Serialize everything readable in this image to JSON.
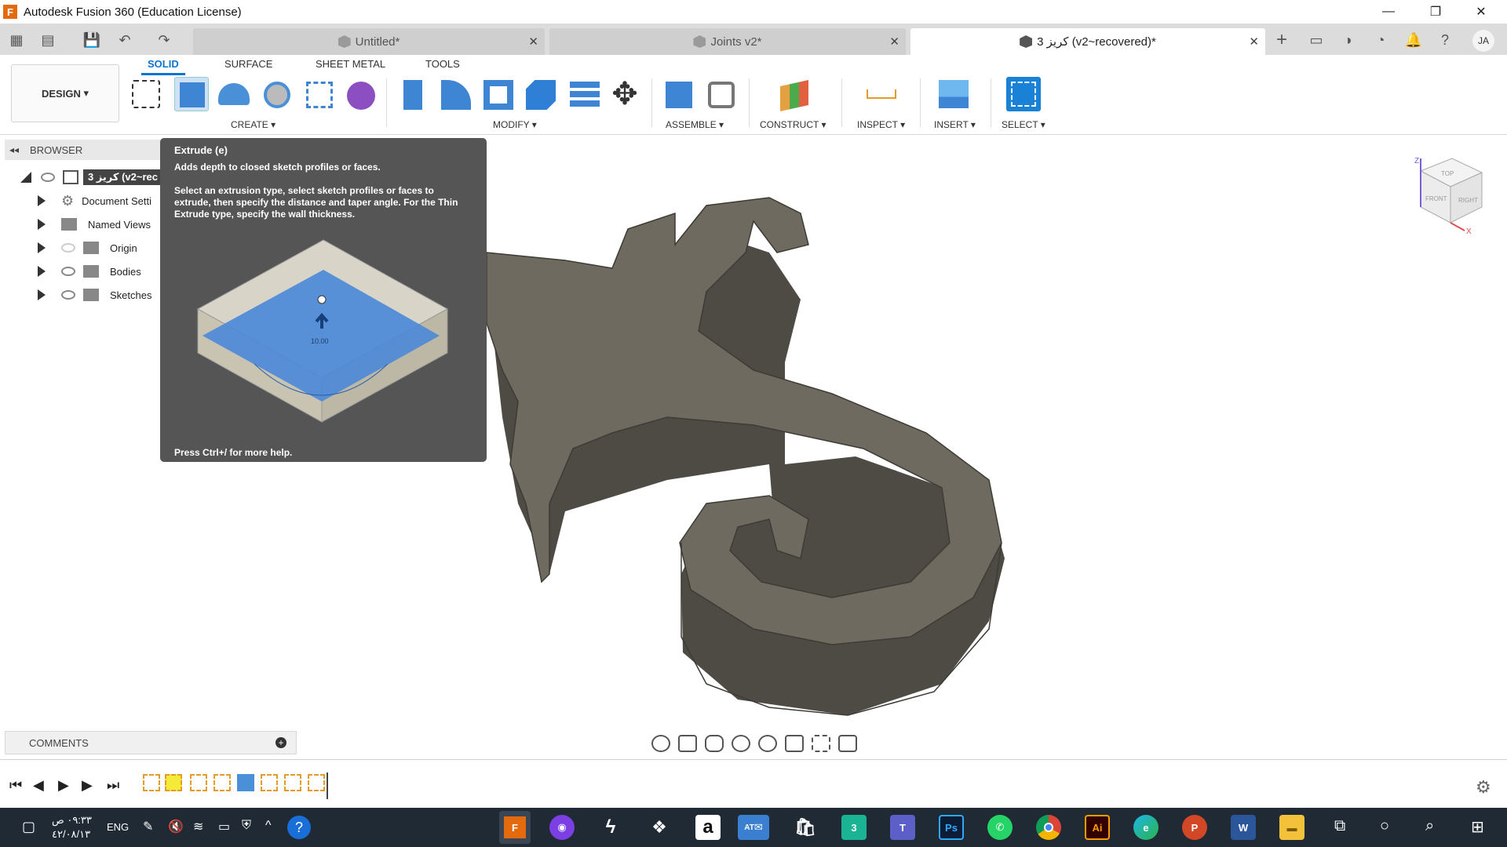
{
  "window": {
    "title": "Autodesk Fusion 360 (Education License)",
    "app_icon_letter": "F"
  },
  "tabs": [
    {
      "label": "Untitled*",
      "active": false
    },
    {
      "label": "Joints v2*",
      "active": false
    },
    {
      "label": "كريز 3 (v2~recovered)*",
      "active": true
    }
  ],
  "user": {
    "initials": "JA"
  },
  "ribbon": {
    "workspace": "DESIGN",
    "tabs": [
      "SOLID",
      "SURFACE",
      "SHEET METAL",
      "TOOLS"
    ],
    "groups": {
      "create": "CREATE",
      "modify": "MODIFY",
      "assemble": "ASSEMBLE",
      "construct": "CONSTRUCT",
      "inspect": "INSPECT",
      "insert": "INSERT",
      "select": "SELECT"
    }
  },
  "browser": {
    "header": "BROWSER",
    "root": "كريز 3 (v2~rec",
    "items": [
      {
        "label": "Document Setti"
      },
      {
        "label": "Named Views"
      },
      {
        "label": "Origin"
      },
      {
        "label": "Bodies"
      },
      {
        "label": "Sketches"
      }
    ]
  },
  "tooltip": {
    "title": "Extrude (e)",
    "description": "Adds depth to closed sketch profiles or faces.",
    "detail": "Select an extrusion type, select sketch profiles or faces to extrude, then specify the distance and taper angle. For the Thin Extrude type, specify the wall thickness.",
    "help": "Press Ctrl+/ for more help.",
    "preview_value": "10.00"
  },
  "viewcube": {
    "top": "TOP",
    "front": "FRONT",
    "right": "RIGHT",
    "axis_z": "Z",
    "axis_x": "X"
  },
  "comments": {
    "label": "COMMENTS"
  },
  "taskbar": {
    "time": "٠٩:٣٣ ص",
    "date": "٤٢/٠٨/١٣",
    "lang": "ENG",
    "mail_badge": "AT",
    "apps": [
      "F",
      "3",
      "Ps",
      "Ai",
      "P",
      "W"
    ]
  },
  "colors": {
    "accent": "#0b74d1",
    "model": "#6e6a60",
    "tooltip_bg": "#555555",
    "taskbar_bg": "#1f2a35"
  }
}
